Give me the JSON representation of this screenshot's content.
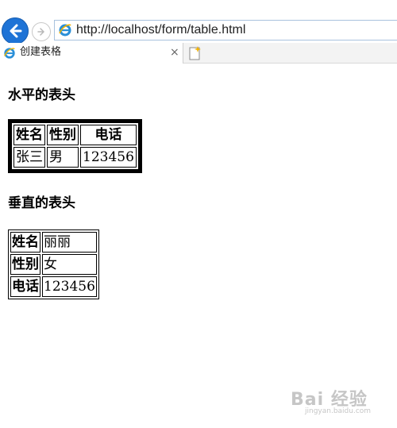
{
  "browser": {
    "url": "http://localhost/form/table.html",
    "tab_title": "创建表格",
    "close_glyph": "×"
  },
  "page": {
    "heading_horizontal": "水平的表头",
    "heading_vertical": "垂直的表头",
    "table_horizontal": {
      "headers": [
        "姓名",
        "性别",
        "电话"
      ],
      "row": [
        "张三",
        "男",
        "123456"
      ]
    },
    "table_vertical": {
      "rows": [
        {
          "header": "姓名",
          "value": "丽丽"
        },
        {
          "header": "性别",
          "value": "女"
        },
        {
          "header": "电话",
          "value": "123456"
        }
      ]
    }
  },
  "watermark": {
    "brand": "Bai 经验",
    "sub": "jingyan.baidu.com"
  },
  "colors": {
    "back_button": "#1e73d6",
    "address_border": "#a9c2de"
  },
  "icons": [
    "back-arrow-icon",
    "forward-arrow-icon",
    "ie-icon",
    "close-icon",
    "new-tab-icon"
  ]
}
